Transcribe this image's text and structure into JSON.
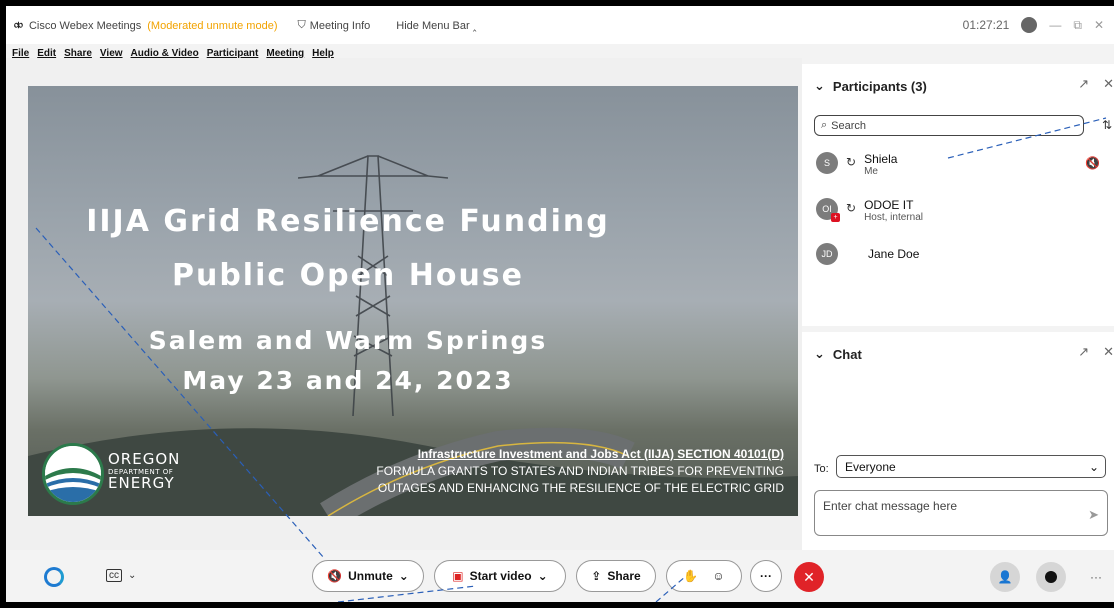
{
  "titlebar": {
    "app_name": "Cisco Webex Meetings",
    "mode": "(Moderated unmute mode)",
    "meeting_info": "Meeting Info",
    "hide_menu": "Hide Menu Bar",
    "time": "01:27:21"
  },
  "menu": [
    "File",
    "Edit",
    "Share",
    "View",
    "Audio & Video",
    "Participant",
    "Meeting",
    "Help"
  ],
  "slide": {
    "line1": "IIJA Grid Resilience Funding",
    "line2": "Public Open House",
    "line3": "Salem and Warm Springs",
    "line4": "May 23 and 24, 2023",
    "org_line1": "OREGON",
    "org_line2": "DEPARTMENT OF",
    "org_line3": "ENERGY",
    "act_heading": "Infrastructure Investment and Jobs Act (IIJA) SECTION 40101(D)",
    "act_line1": "FORMULA GRANTS TO STATES AND INDIAN TRIBES FOR PREVENTING",
    "act_line2": "OUTAGES AND ENHANCING THE RESILIENCE OF THE ELECTRIC GRID"
  },
  "participants": {
    "title": "Participants (3)",
    "search_placeholder": "Search",
    "list": [
      {
        "initials": "S",
        "name": "Shiela",
        "sub": "Me"
      },
      {
        "initials": "OI",
        "name": "ODOE IT",
        "sub": "Host, internal"
      },
      {
        "initials": "JD",
        "name": "Jane Doe",
        "sub": ""
      }
    ]
  },
  "chat": {
    "title": "Chat",
    "to_label": "To:",
    "to_value": "Everyone",
    "input_placeholder": "Enter chat message here"
  },
  "toolbar": {
    "unmute": "Unmute",
    "start_video": "Start video",
    "share": "Share",
    "more": "···"
  },
  "colors": {
    "accent_mode": "#f2a300",
    "end_call": "#e02328",
    "mute_red": "#d22222",
    "webex_blue": "#1e7bd1"
  }
}
